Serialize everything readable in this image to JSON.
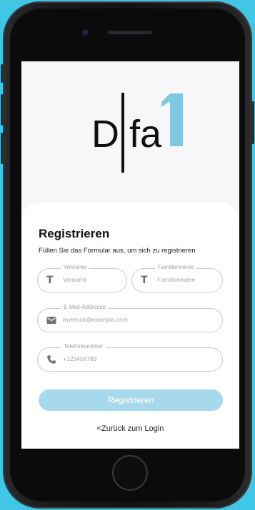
{
  "brand": {
    "logo_text": "Difa1",
    "accent": "#7ec8e3"
  },
  "form": {
    "title": "Registrieren",
    "subtitle": "Füllen Sie das Formular aus, um sich zu registrieren",
    "first_name": {
      "label": "Vorname",
      "placeholder": "Vorname",
      "icon": "text-icon"
    },
    "last_name": {
      "label": "Familienname",
      "placeholder": "Familienname",
      "icon": "text-icon"
    },
    "email": {
      "label": "E-Mail-Addresse",
      "placeholder": "myemail@example.com",
      "icon": "mail-icon"
    },
    "phone": {
      "label": "Telefonnummer",
      "placeholder": "+123456789",
      "icon": "phone-icon"
    },
    "submit_label": "Registrieren",
    "back_link": "<Zurück zum Login"
  },
  "colors": {
    "button": "#a7d9ec",
    "background": "#3fc7e5"
  }
}
